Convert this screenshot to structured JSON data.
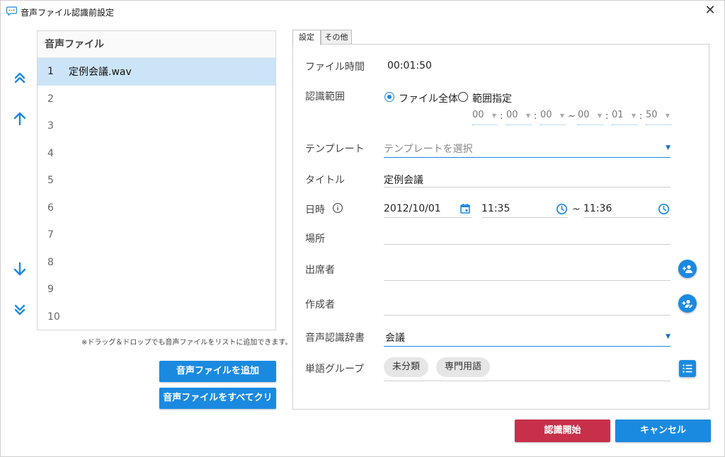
{
  "window": {
    "title": "音声ファイル認識前設定",
    "close_glyph": "✕"
  },
  "file_list": {
    "header": "音声ファイル",
    "rows": [
      {
        "num": "1",
        "name": "定例会議.wav"
      },
      {
        "num": "2",
        "name": ""
      },
      {
        "num": "3",
        "name": ""
      },
      {
        "num": "4",
        "name": ""
      },
      {
        "num": "5",
        "name": ""
      },
      {
        "num": "6",
        "name": ""
      },
      {
        "num": "7",
        "name": ""
      },
      {
        "num": "8",
        "name": ""
      },
      {
        "num": "9",
        "name": ""
      },
      {
        "num": "10",
        "name": ""
      }
    ],
    "hint": "※ドラッグ＆ドロップでも音声ファイルをリストに追加できます。",
    "add_button": "音声ファイルを追加",
    "clear_button": "音声ファイルをすべてクリア"
  },
  "tabs": [
    {
      "label": "設定",
      "active": true
    },
    {
      "label": "その他",
      "active": false
    }
  ],
  "form": {
    "file_time": {
      "label": "ファイル時間",
      "value": "00:01:50"
    },
    "range": {
      "label": "認識範囲",
      "option_all": "ファイル全体",
      "option_specify": "範囲指定",
      "selected": "ファイル全体",
      "start": [
        "00",
        "00",
        "00"
      ],
      "end": [
        "00",
        "01",
        "50"
      ],
      "sep_colon": ":",
      "sep_tilde": "~"
    },
    "template": {
      "label": "テンプレート",
      "placeholder": "テンプレートを選択"
    },
    "title": {
      "label": "タイトル",
      "value": "定例会議"
    },
    "datetime": {
      "label": "日時",
      "date": "2012/10/01",
      "start_time": "11:35",
      "end_time": "11:36",
      "tilde": "~"
    },
    "place": {
      "label": "場所",
      "value": ""
    },
    "attendees": {
      "label": "出席者",
      "value": ""
    },
    "author": {
      "label": "作成者",
      "value": ""
    },
    "dictionary": {
      "label": "音声認識辞書",
      "value": "会議"
    },
    "word_group": {
      "label": "単語グループ",
      "chips": [
        "未分類",
        "専門用語"
      ]
    }
  },
  "footer": {
    "start_button": "認識開始",
    "cancel_button": "キャンセル"
  },
  "colors": {
    "accent": "#1a8ae0",
    "start": "#c8304a",
    "selection": "#cce4f7"
  }
}
